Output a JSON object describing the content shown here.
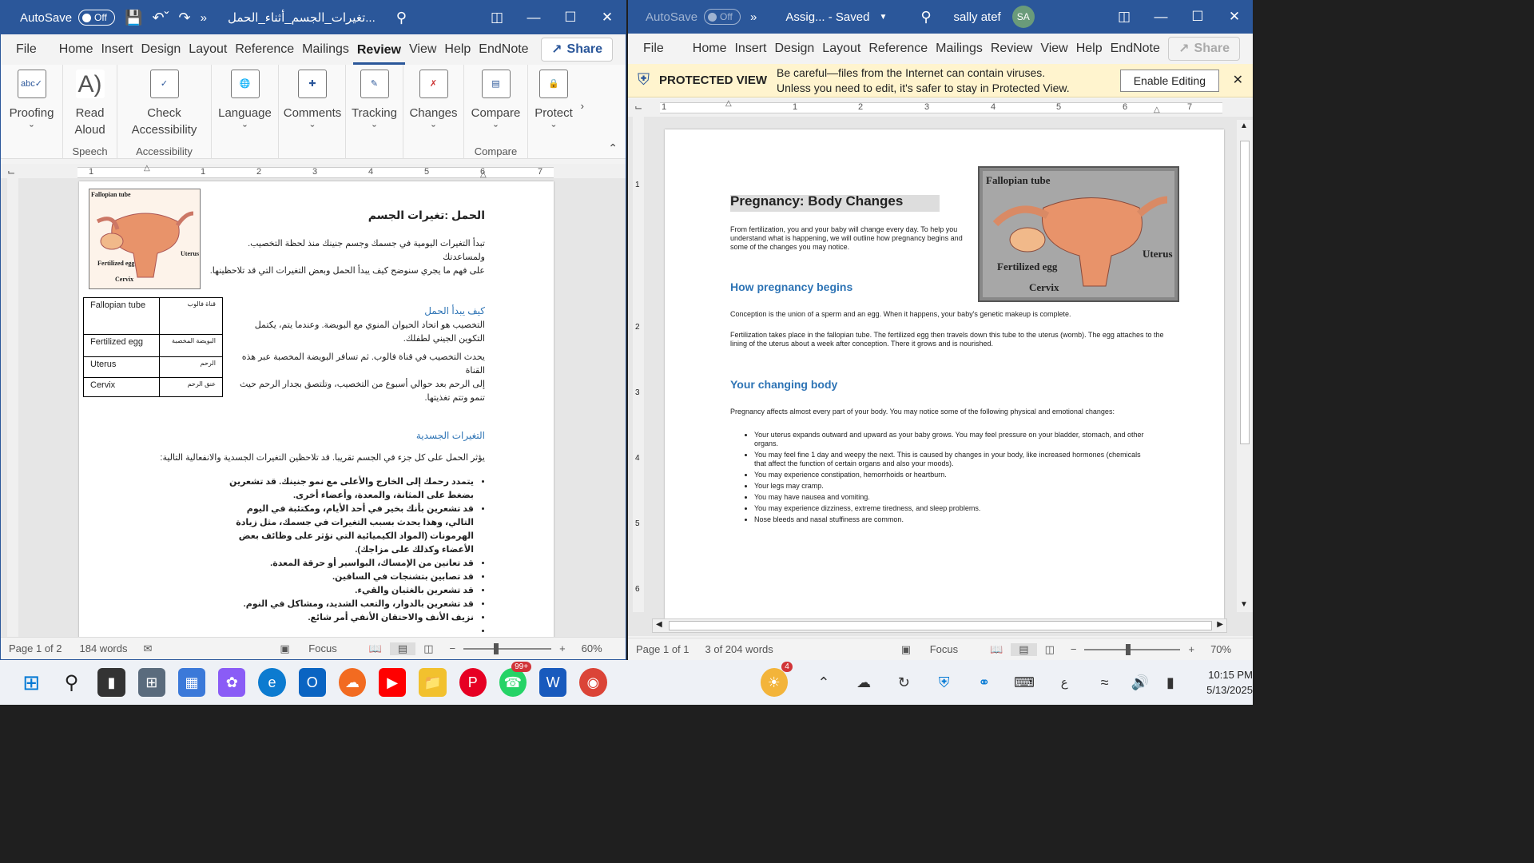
{
  "left": {
    "autosave_label": "AutoSave",
    "autosave_state": "Off",
    "doc_title": "تغيرات_الجسم_أثناء_الحمل...",
    "menu": [
      "File",
      "Home",
      "Insert",
      "Design",
      "Layout",
      "Reference",
      "Mailings",
      "Review",
      "View",
      "Help",
      "EndNote"
    ],
    "active_menu": "Review",
    "share_label": "Share",
    "ribbon": {
      "proofing": "Proofing",
      "read_aloud_1": "Read",
      "read_aloud_2": "Aloud",
      "speech_group": "Speech",
      "check_acc_1": "Check",
      "check_acc_2": "Accessibility",
      "accessibility_group": "Accessibility",
      "language": "Language",
      "comments": "Comments",
      "tracking": "Tracking",
      "changes": "Changes",
      "compare": "Compare",
      "compare_group": "Compare",
      "protect": "Protect"
    },
    "ruler_nums": [
      "1",
      "1",
      "2",
      "3",
      "4",
      "5",
      "6",
      "7"
    ],
    "fig": {
      "fallopian": "Fallopian tube",
      "fertilized": "Fertilized egg",
      "cervix": "Cervix",
      "uterus": "Uterus"
    },
    "title_ar": "الحمل :تغيرات الجسم",
    "intro_ar_1": "تبدأ التغيرات اليومية في جسمك وجسم جنينك منذ لحظة التخصيب. ولمساعدتك",
    "intro_ar_2": "على فهم ما يجري سنوضح كيف يبدأ الحمل وبعض التغيرات التي قد تلاحظينها.",
    "table": [
      [
        "Fallopian tube",
        "قناة فالوب"
      ],
      [
        "Fertilized egg",
        "البويضة المخصبة"
      ],
      [
        "Uterus",
        "الرحم"
      ],
      [
        "Cervix",
        "عنق الرحم"
      ]
    ],
    "h_begin_ar": "كيف يبدأ الحمل",
    "begin_ar_1": "التخصيب هو اتحاد الحيوان المنوي مع البويضة. وعندما يتم، يكتمل",
    "begin_ar_2": "التكوين الجيني لطفلك.",
    "begin_ar_3": "يحدث التخصيب في قناة فالوب. ثم تسافر البويضة المخصبة عبر هذه القناة",
    "begin_ar_4": "إلى الرحم بعد حوالي أسبوع من التخصيب، وتلتصق بجدار الرحم حيث",
    "begin_ar_5": "تنمو وتتم تغذيتها.",
    "h_changes_ar": "التغيرات الجسدية",
    "changes_ar": "يؤثر الحمل على كل جزء في الجسم تقريبا. قد تلاحظين التغيرات الجسدية والانفعالية التالية:",
    "bullets_ar": [
      "يتمدد رحمك إلى الخارج والأعلى مع نمو جنينك. قد تشعرين بضغط على المثانة، والمعدة، وأعضاء أخرى.",
      "قد تشعرين بأنك بخير في أحد الأيام، ومكتئبة في اليوم التالي، وهذا يحدث بسبب التغيرات في جسمك، مثل زيادة الهرمونات (المواد الكيميائية التي تؤثر على وظائف بعض الأعضاء وكذلك على مزاجك).",
      "قد تعانين من الإمساك، البواسير أو حرقة المعدة.",
      "قد تصابين بتشنجات في الساقين.",
      "قد تشعرين بالغثيان والقيء.",
      "قد تشعرين بالدوار، والتعب الشديد، ومشاكل في النوم.",
      "نزيف الأنف والاحتقان الأنفي أمر شائع.",
      ""
    ],
    "status": {
      "page": "Page 1 of 2",
      "words": "184 words",
      "focus": "Focus",
      "zoom": "60%"
    }
  },
  "right": {
    "autosave_label": "AutoSave",
    "autosave_state": "Off",
    "doc_title": "Assig... - Saved",
    "user": "sally atef",
    "initials": "SA",
    "menu": [
      "File",
      "Home",
      "Insert",
      "Design",
      "Layout",
      "Reference",
      "Mailings",
      "Review",
      "View",
      "Help",
      "EndNote"
    ],
    "share_label": "Share",
    "protected_title": "PROTECTED VIEW",
    "protected_msg_1": "Be careful—files from the Internet can contain viruses.",
    "protected_msg_2": "Unless you need to edit, it's safer to stay in Protected View.",
    "enable_label": "Enable Editing",
    "ruler_nums": [
      "1",
      "1",
      "2",
      "3",
      "4",
      "5",
      "6",
      "7"
    ],
    "vruler_nums": [
      "1",
      "2",
      "3",
      "4",
      "5",
      "6"
    ],
    "title": "Pregnancy: Body Changes",
    "intro": "From fertilization, you and your baby will change every day. To help you understand what is happening, we will outline how pregnancy begins and some of the changes you may notice.",
    "h_begin": "How pregnancy begins",
    "begin_1": "Conception is the union of a sperm and an egg. When it happens, your baby's genetic makeup is complete.",
    "begin_2": "Fertilization takes place in the fallopian tube. The fertilized egg then travels down this tube to the uterus (womb). The egg attaches to the lining of the uterus about a week after conception. There it grows and is nourished.",
    "h_changes": "Your changing body",
    "changes": "Pregnancy affects almost every part of your body. You may notice some of the following physical and emotional changes:",
    "bullets": [
      "Your uterus expands outward and upward as your baby grows. You may feel pressure on your bladder, stomach, and other organs.",
      "You may feel fine 1 day and weepy the next. This is caused by changes in your body, like increased hormones (chemicals that affect the function of certain organs and also your moods).",
      "You may experience constipation, hemorrhoids or heartburn.",
      "Your legs may cramp.",
      "You may have nausea and vomiting.",
      "You may experience dizziness, extreme tiredness, and sleep problems.",
      "Nose bleeds and nasal stuffiness are common."
    ],
    "fig": {
      "fallopian": "Fallopian tube",
      "fertilized": "Fertilized egg",
      "cervix": "Cervix",
      "uterus": "Uterus"
    },
    "status": {
      "page": "Page 1 of 1",
      "words": "3 of 204 words",
      "focus": "Focus",
      "zoom": "70%"
    }
  },
  "taskbar": {
    "whatsapp_badge": "99+",
    "weather_badge": "4",
    "lang": "ع",
    "time": "10:15 PM",
    "date": "5/13/2025"
  }
}
